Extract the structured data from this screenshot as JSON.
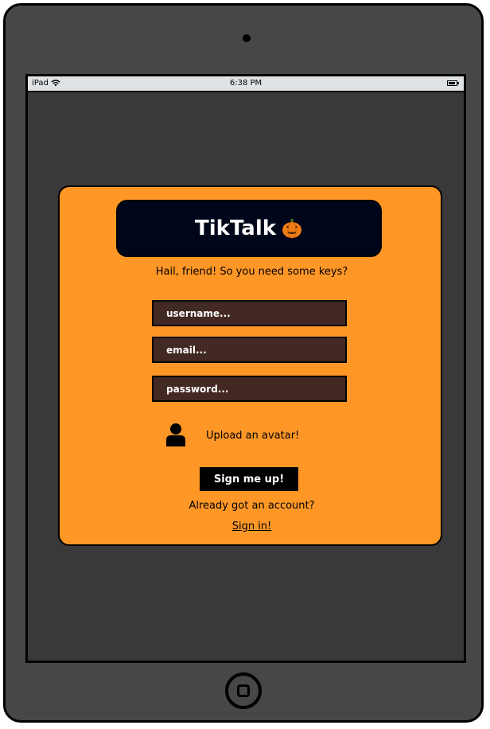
{
  "status_bar": {
    "carrier": "iPad",
    "time": "6:38 PM",
    "wifi_icon": "wifi-icon",
    "battery_icon": "battery-icon"
  },
  "app": {
    "title": "TikTalk",
    "logo_icon": "pumpkin-icon",
    "tagline": "Hail, friend! So you need some keys?"
  },
  "form": {
    "username_placeholder": "username...",
    "email_placeholder": "email...",
    "password_placeholder": "password...",
    "avatar_icon": "user-icon",
    "avatar_label": "Upload an avatar!",
    "submit_label": "Sign me up!"
  },
  "footer": {
    "question": "Already got an account?",
    "signin_label": "Sign in!"
  },
  "colors": {
    "card_bg": "#ff9727",
    "logo_bg": "#000619",
    "field_bg": "#422923",
    "device_bg": "#474747",
    "screen_bg": "#393939"
  }
}
